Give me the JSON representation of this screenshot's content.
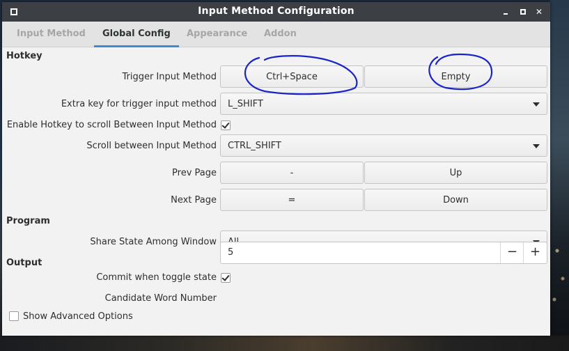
{
  "window": {
    "title": "Input Method Configuration"
  },
  "tabs": [
    {
      "label": "Input Method",
      "active": false
    },
    {
      "label": "Global Config",
      "active": true
    },
    {
      "label": "Appearance",
      "active": false
    },
    {
      "label": "Addon",
      "active": false
    }
  ],
  "sections": {
    "hotkey": "Hotkey",
    "program": "Program",
    "output": "Output"
  },
  "hotkey": {
    "trigger_label": "Trigger Input Method",
    "trigger_primary": "Ctrl+Space",
    "trigger_secondary": "Empty",
    "extra_key_label": "Extra key for trigger input method",
    "extra_key_value": "L_SHIFT",
    "enable_scroll_label": "Enable Hotkey to scroll Between Input Method",
    "enable_scroll_checked": true,
    "scroll_label": "Scroll between Input Method",
    "scroll_value": "CTRL_SHIFT",
    "prev_page_label": "Prev Page",
    "prev_page_primary": "-",
    "prev_page_secondary": "Up",
    "next_page_label": "Next Page",
    "next_page_primary": "=",
    "next_page_secondary": "Down"
  },
  "program": {
    "share_state_label": "Share State Among Window",
    "share_state_value": "All"
  },
  "output": {
    "commit_label": "Commit when toggle state",
    "commit_checked": true,
    "candidate_label": "Candidate Word Number",
    "candidate_value": "5",
    "decrement": "−",
    "increment": "+"
  },
  "advanced": {
    "label": "Show Advanced Options",
    "checked": false
  },
  "icons": {
    "close": "✕",
    "dropdown": "dropdown-arrow-icon"
  },
  "colors": {
    "accent": "#3b8cd6",
    "titlebar": "#3c3f43",
    "annotation": "#1a24c8"
  }
}
